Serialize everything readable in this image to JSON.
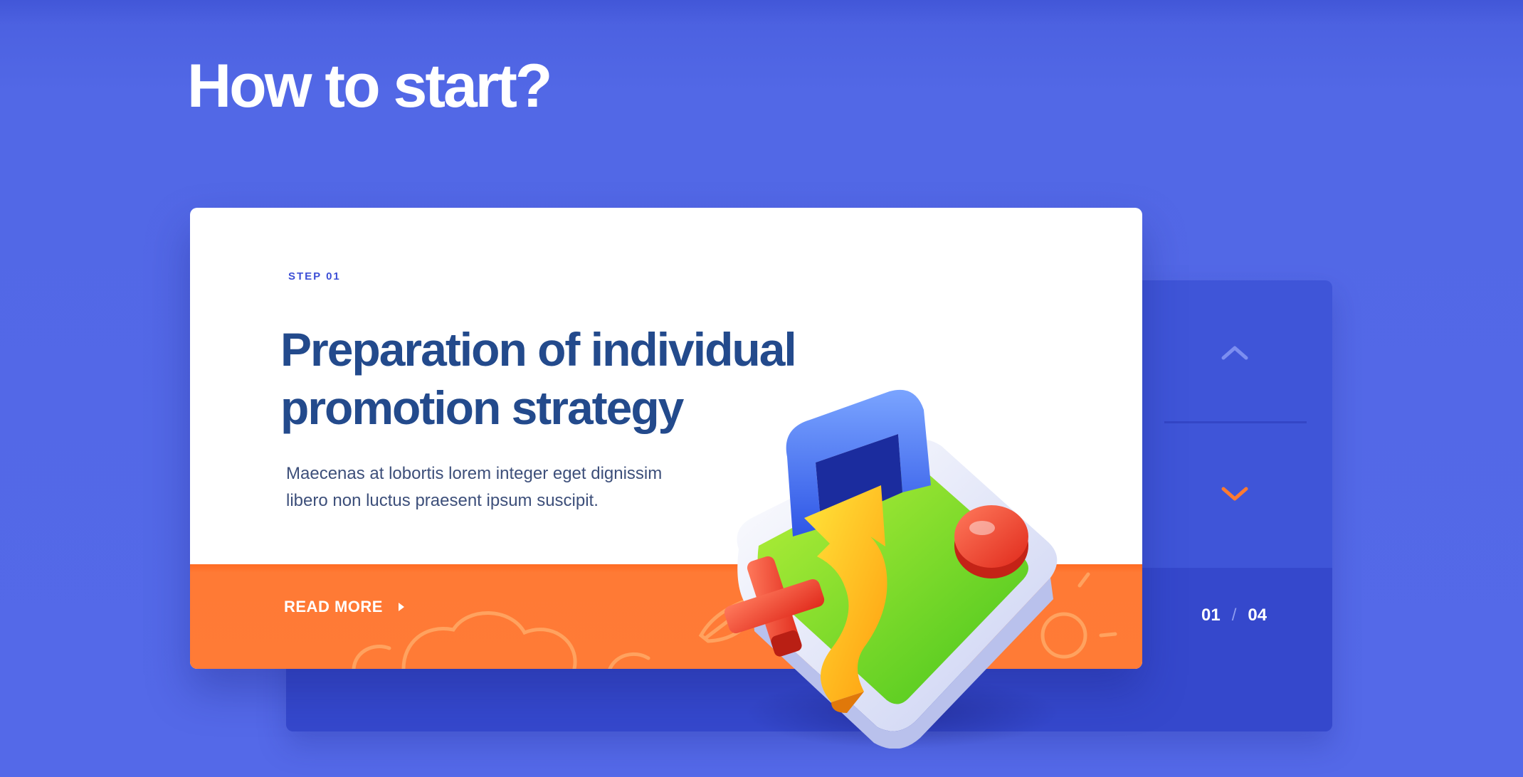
{
  "page": {
    "title": "How to start?"
  },
  "card": {
    "step_label": "STEP 01",
    "title_line1": "Preparation of individual",
    "title_line2": "promotion strategy",
    "description_line1": "Maecenas at lobortis lorem integer eget dignissim",
    "description_line2": "libero non luctus praesent ipsum suscipit.",
    "read_more_label": "READ MORE"
  },
  "navigation": {
    "current": "01",
    "separator": "/",
    "total": "04",
    "up_icon": "chevron-up-icon",
    "down_icon": "chevron-down-icon"
  },
  "colors": {
    "background": "#5469e8",
    "accent_orange": "#ff7b36",
    "title_blue": "#234a8c",
    "step_blue": "#3d4fd6"
  }
}
